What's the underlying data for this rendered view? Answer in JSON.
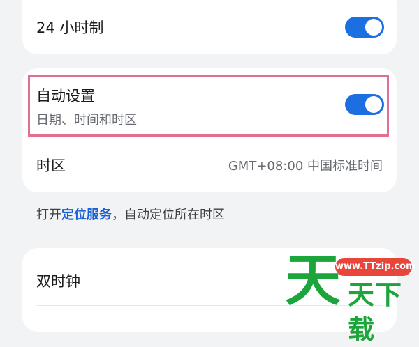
{
  "settings": {
    "clock24": {
      "label": "24 小时制",
      "enabled": true
    },
    "auto_set": {
      "label": "自动设置",
      "sublabel": "日期、时间和时区",
      "enabled": true
    },
    "timezone": {
      "label": "时区",
      "value": "GMT+08:00 中国标准时间"
    },
    "location_note": {
      "prefix": "打开",
      "link": "定位服务",
      "suffix": "，自动定位所在时区"
    },
    "dual_clock": {
      "label": "双时钟"
    }
  },
  "watermark": {
    "site": "www.TTzip.com",
    "big_char": "天",
    "text": "天下载"
  },
  "colors": {
    "accent": "#1b5fd6",
    "toggle_on": "#1b6fe0",
    "highlight": "#e0708f",
    "watermark_green": "#1ba53a",
    "watermark_red": "#e8463b"
  }
}
